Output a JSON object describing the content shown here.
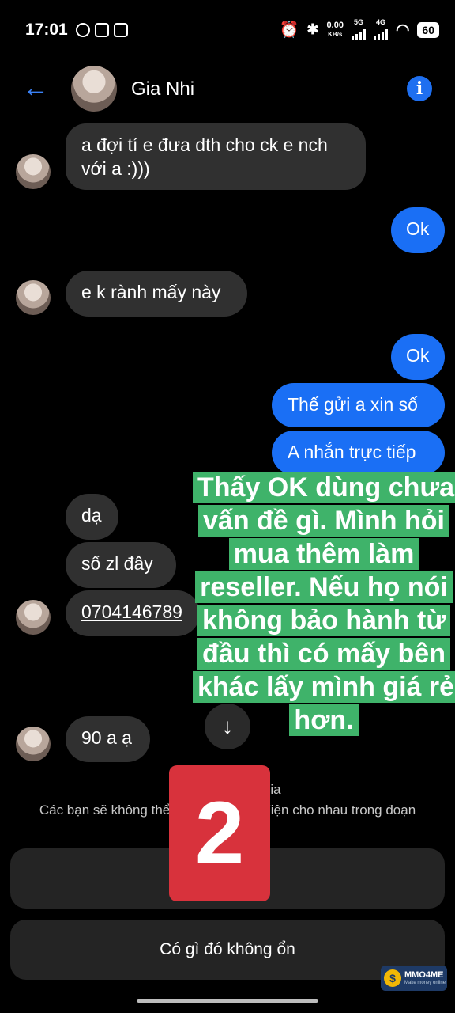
{
  "status_bar": {
    "time": "17:01",
    "net_speed_value": "0.00",
    "net_speed_unit": "KB/s",
    "signal1_label": "5G",
    "signal2_label": "4G",
    "battery": "60"
  },
  "header": {
    "contact_name": "Gia Nhi"
  },
  "messages": [
    {
      "side": "in",
      "text": "a đợi tí e đưa dth cho ck e nch với a :)))"
    },
    {
      "side": "out",
      "text": "Ok"
    },
    {
      "side": "in",
      "text": "e k rành mấy này"
    },
    {
      "side": "out",
      "text": "Ok"
    },
    {
      "side": "out",
      "text": "Thế gửi a xin số"
    },
    {
      "side": "out",
      "text": "A nhắn trực tiếp"
    },
    {
      "side": "in",
      "text": "dạ"
    },
    {
      "side": "in",
      "text": "số zl đây"
    },
    {
      "side": "in",
      "text": "0704146789"
    },
    {
      "side": "in",
      "text": "90 a ạ"
    }
  ],
  "overlay_caption": "Thấy OK dùng chưa vấn đề gì. Mình hỏi mua thêm làm reseller. Nếu họ nói không bảo hành từ đầu thì có mấy bên khác lấy mình giá rẻ hơn.",
  "notice": {
    "line1": "ia",
    "line2": "Các bạn sẽ không thể n                      điện cho nhau trong đoạn"
  },
  "badge_number": "2",
  "actions": {
    "report_label": "Có gì đó không ổn"
  },
  "watermark": {
    "name": "MMO4ME",
    "tagline": "Make money online"
  },
  "colors": {
    "outgoing_bubble": "#1a6ff5",
    "incoming_bubble": "#303030",
    "caption_bg": "#3fb36a",
    "badge_bg": "#d8323c"
  }
}
